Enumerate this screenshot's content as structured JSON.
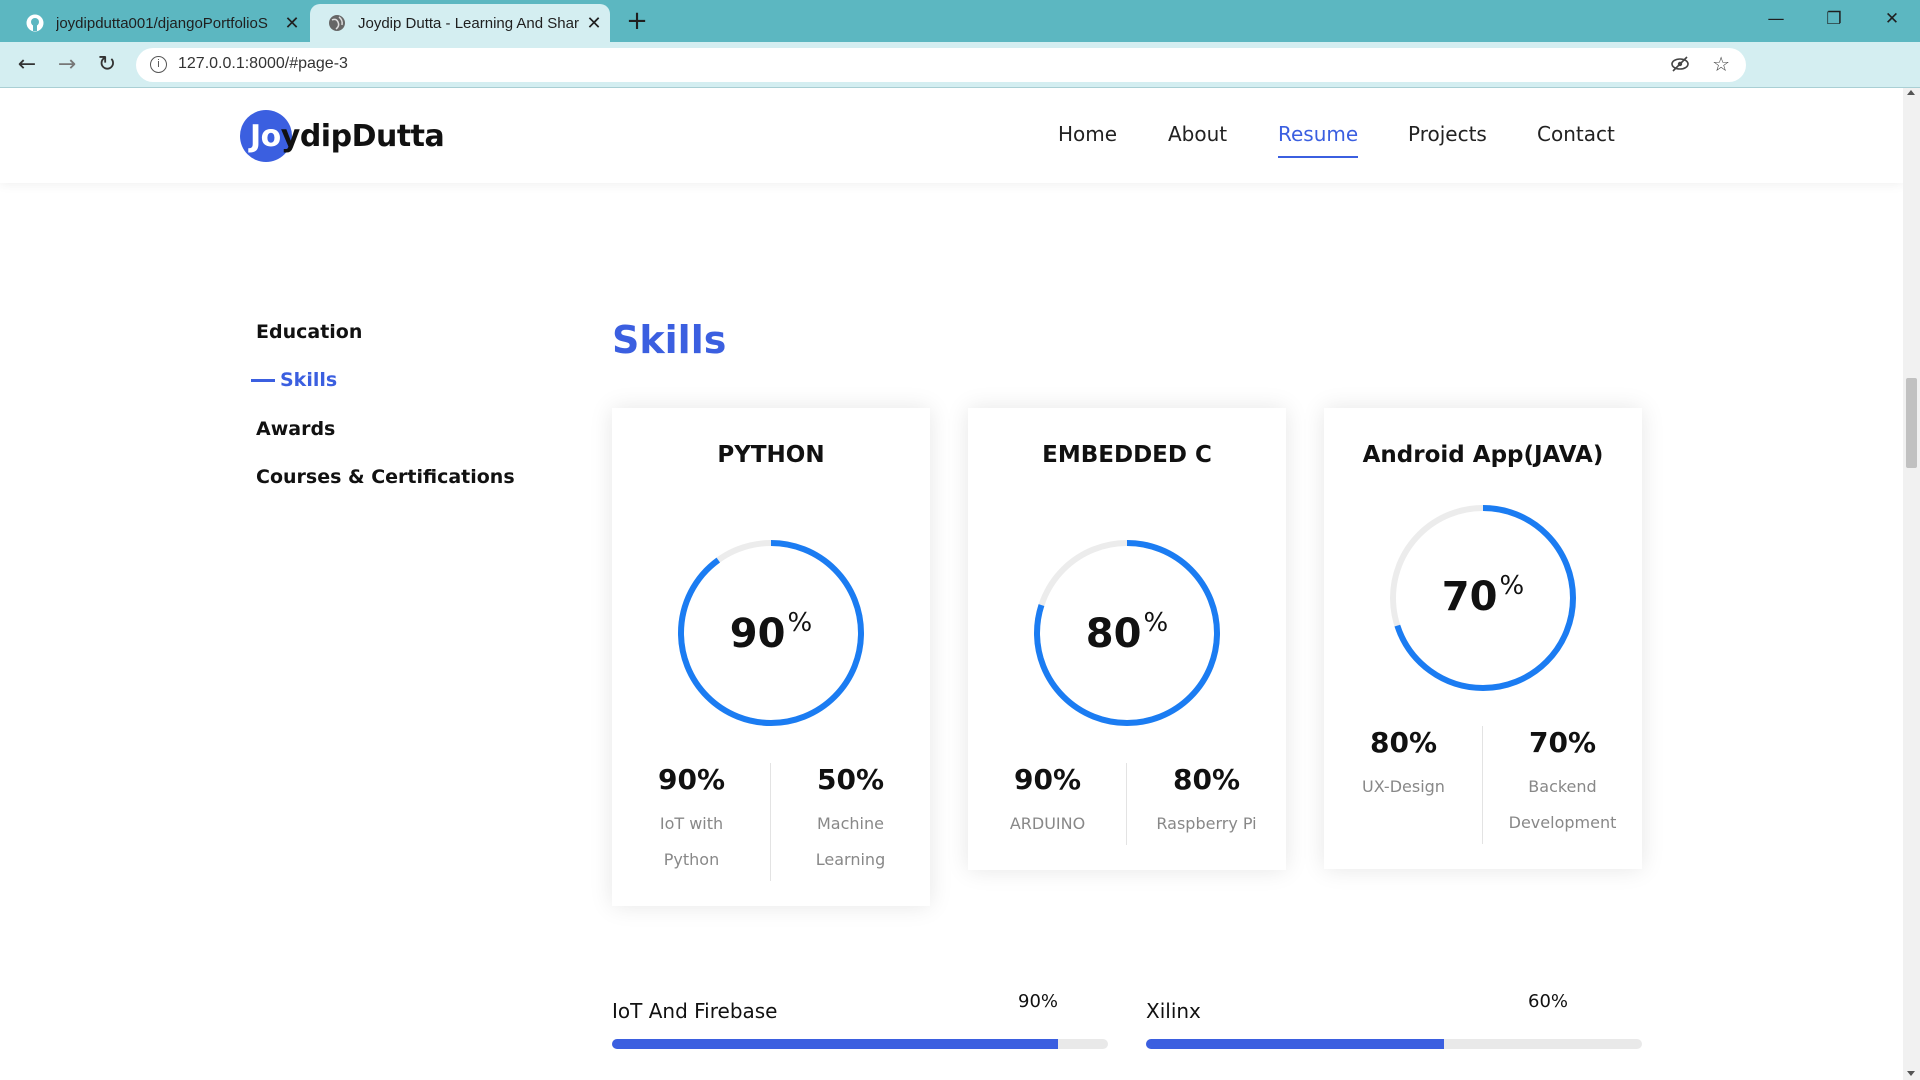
{
  "browser": {
    "tabs": [
      {
        "title": "joydipdutta001/djangoPortfolioS",
        "icon": "github-icon"
      },
      {
        "title": "Joydip Dutta - Learning And Shar",
        "icon": "globe-icon"
      }
    ],
    "url": "127.0.0.1:8000/#page-3"
  },
  "site": {
    "logo_prefix": "Jo",
    "logo_rest": "ydipDutta",
    "nav": [
      {
        "label": "Home",
        "active": false
      },
      {
        "label": "About",
        "active": false
      },
      {
        "label": "Resume",
        "active": true
      },
      {
        "label": "Projects",
        "active": false
      },
      {
        "label": "Contact",
        "active": false
      }
    ]
  },
  "side_menu": [
    {
      "label": "Education",
      "active": false
    },
    {
      "label": "Skills",
      "active": true
    },
    {
      "label": "Awards",
      "active": false
    },
    {
      "label": "Courses & Certifications",
      "active": false
    }
  ],
  "section_title": "Skills",
  "skill_cards": [
    {
      "title": "PYTHON",
      "percent": 90,
      "percent_text": "90",
      "stats": [
        {
          "value": "90%",
          "label": "IoT with Python"
        },
        {
          "value": "50%",
          "label": "Machine Learning"
        }
      ]
    },
    {
      "title": "EMBEDDED C",
      "percent": 80,
      "percent_text": "80",
      "stats": [
        {
          "value": "90%",
          "label": "ARDUINO"
        },
        {
          "value": "80%",
          "label": "Raspberry Pi"
        }
      ]
    },
    {
      "title": "Android App(JAVA)",
      "percent": 70,
      "percent_text": "70",
      "stats": [
        {
          "value": "80%",
          "label": "UX-Design"
        },
        {
          "value": "70%",
          "label": "Backend Development"
        }
      ]
    }
  ],
  "progress_bars": [
    {
      "label": "IoT And Firebase",
      "percent": 90,
      "percent_text": "90%"
    },
    {
      "label": "Xilinx",
      "percent": 60,
      "percent_text": "60%"
    }
  ],
  "colors": {
    "accent": "#3b5fe0",
    "ring": "#1b7cf2",
    "ring_track": "#ececec",
    "chrome": "#5cb7c1"
  }
}
